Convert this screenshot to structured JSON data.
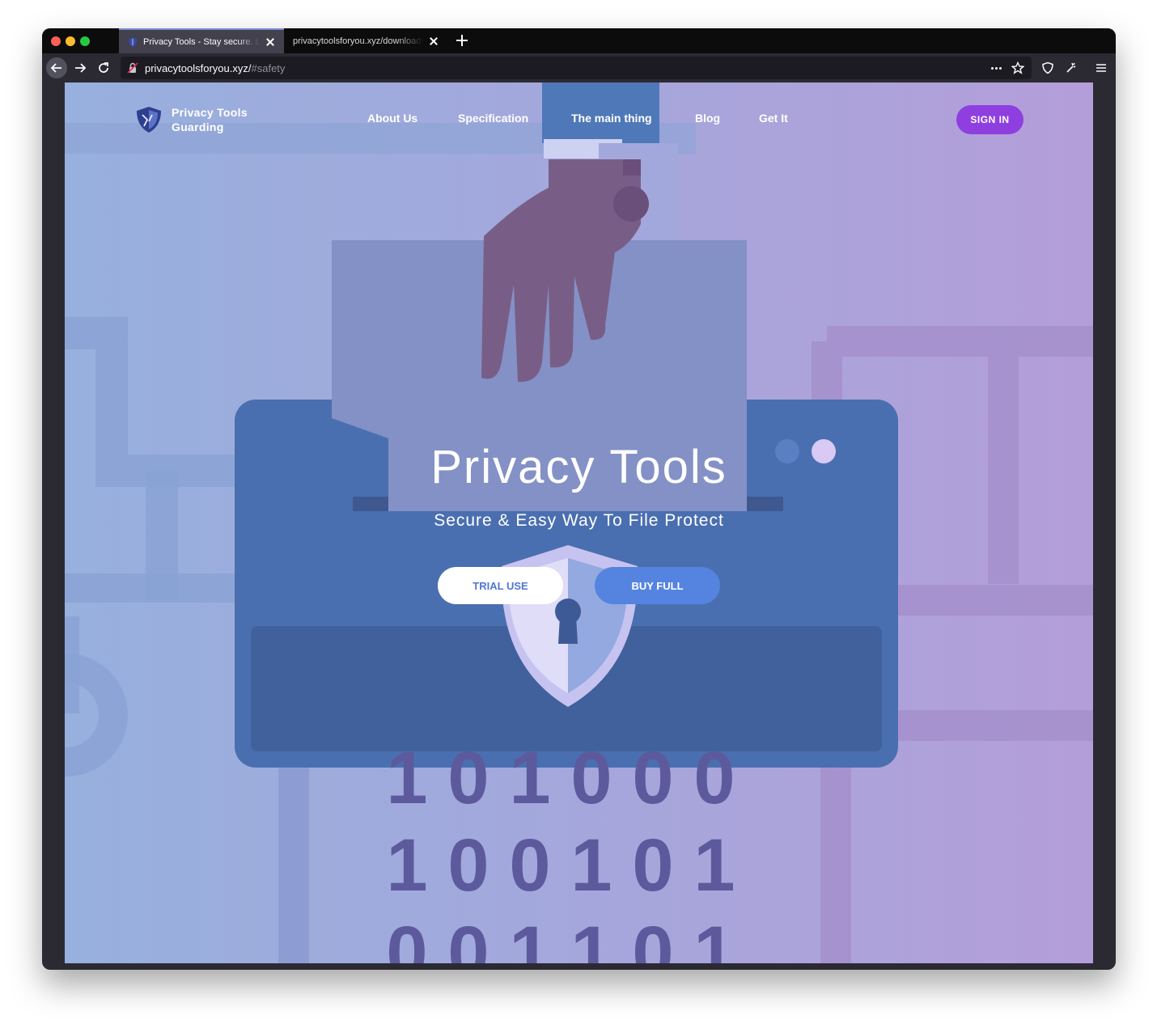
{
  "browser": {
    "tabs": [
      {
        "title": "Privacy Tools - Stay secure. Live safe",
        "active": true
      },
      {
        "title": "privacytoolsforyou.xyz/downloads/sa",
        "active": false
      }
    ],
    "url_host": "privacytoolsforyou.xyz/",
    "url_path": "#safety"
  },
  "site": {
    "logo_line1": "Privacy Tools",
    "logo_line2": "Guarding",
    "menu": [
      "About Us",
      "Specification",
      "The main thing",
      "Blog",
      "Get It"
    ],
    "signin_label": "SIGN IN"
  },
  "hero": {
    "title": "Privacy Tools",
    "subtitle": "Secure & Easy Way To File Protect",
    "trial_label": "TRIAL USE",
    "buy_label": "BUY FULL"
  },
  "binary_rows": [
    [
      "1",
      "0",
      "1",
      "0",
      "0",
      "0"
    ],
    [
      "1",
      "0",
      "0",
      "1",
      "0",
      "1"
    ],
    [
      "0",
      "0",
      "1",
      "1",
      "0",
      "1"
    ]
  ],
  "colors": {
    "accent_purple": "#8f3fe0",
    "button_blue": "#5584e0"
  },
  "icons": [
    "shield-logo-icon",
    "back-icon",
    "forward-icon",
    "reload-icon",
    "site-insecure-icon",
    "more-icon",
    "bookmark-star-icon",
    "tracking-shield-icon",
    "extension-icon",
    "menu-icon"
  ]
}
